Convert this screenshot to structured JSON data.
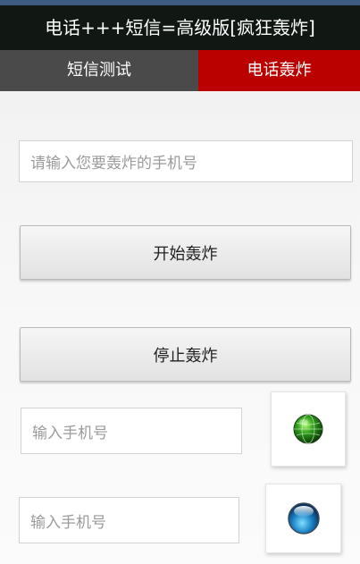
{
  "app": {
    "title": "电话+++短信=高级版[疯狂轰炸]"
  },
  "tabs": [
    {
      "label": "短信测试",
      "active": false
    },
    {
      "label": "电话轰炸",
      "active": true
    }
  ],
  "main": {
    "phone_input": {
      "placeholder": "请输入您要轰炸的手机号",
      "value": ""
    },
    "start_button": {
      "label": "开始轰炸"
    },
    "stop_button": {
      "label": "停止轰炸"
    },
    "extra_inputs": [
      {
        "placeholder": "输入手机号",
        "value": ""
      },
      {
        "placeholder": "输入手机号",
        "value": ""
      }
    ],
    "image_buttons": [
      {
        "icon": "green-globe-icon"
      },
      {
        "icon": "blue-orb-icon"
      }
    ]
  },
  "colors": {
    "titlebar_bg": "#111713",
    "tab_inactive_bg": "#4a4a4a",
    "tab_active_bg": "#bb0000",
    "top_strip": "#3d5a80"
  }
}
